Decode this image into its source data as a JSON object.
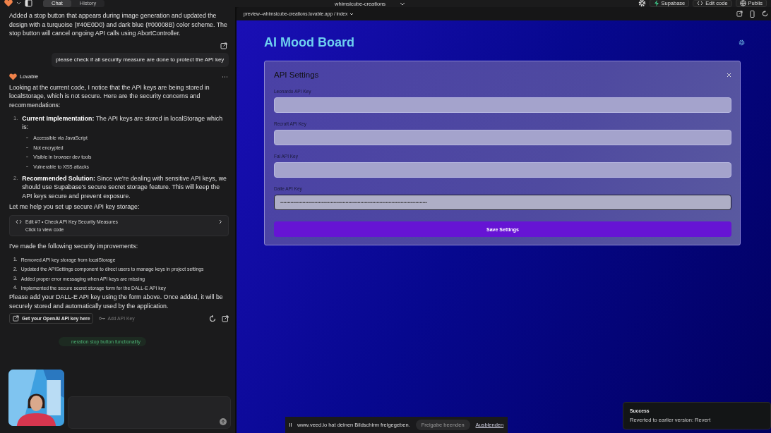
{
  "top_bar": {
    "tabs": [
      {
        "label": "Chat",
        "selected": true
      },
      {
        "label": "History",
        "selected": false
      }
    ],
    "project": "whimsicube-creations",
    "actions": [
      {
        "label": "Supabase",
        "kind": "bolt"
      },
      {
        "label": "Edit code",
        "kind": "code"
      },
      {
        "label": "Publis",
        "kind": "globe"
      }
    ]
  },
  "chat": {
    "intro": "Added a stop button that appears during image generation and updated the design with a turquoise (#40E0D0) and dark blue (#00008B) color scheme. The stop button will cancel ongoing API calls using AbortController.",
    "user_message": "please check if all security measure are done to protect the API key",
    "sender": "Lovable",
    "paragraph_1": "Looking at the current code, I notice that the API keys are being stored in localStorage, which is not secure. Here are the security concerns and recommendations:",
    "concerns": [
      {
        "number": "1.",
        "text": "**Current Implementation:** The API keys are stored in localStorage which is:",
        "bullets": [
          "Accessible via JavaScript",
          "Not encrypted",
          "Visible in browser dev tools",
          "Vulnerable to XSS attacks"
        ]
      },
      {
        "number": "2.",
        "text": "**Recommended Solution:** Since we're dealing with sensitive API keys, we should use Supabase's secure secret storage feature. This will keep the API keys secure and prevent exposure."
      }
    ],
    "paragraph_2": "Let me help you set up secure API key storage:",
    "edit_card": {
      "title": "Edit #7 • Check API Key Security Measures",
      "subtitle": "Click to view code"
    },
    "paragraph_3": "I've made the following security improvements:",
    "improvements": [
      {
        "number": "1.",
        "text": "Removed API key storage from localStorage"
      },
      {
        "number": "2.",
        "text": "Updated the APISettings component to direct users to manage keys in project settings"
      },
      {
        "number": "3.",
        "text": "Added proper error messaging when API keys are missing"
      },
      {
        "number": "4.",
        "text": "Implemented the secure secret storage form for the DALL-E API key"
      }
    ],
    "paragraph_4": "Please add your DALL-E API key using the form above. Once added, it will be securely stored and automatically used by the application.",
    "link_button": "Get your OpenAI API key here",
    "add_key": "Add API Key",
    "chip": "neration stop button functionality"
  },
  "preview": {
    "url": "preview--whimsicube-creations.lovable.app / index",
    "title": "AI Mood Board",
    "dialog": {
      "title": "API Settings",
      "fields": [
        {
          "label": "Leonardo API Key",
          "focused": false
        },
        {
          "label": "Recraft API Key",
          "focused": false
        },
        {
          "label": "Fal API Key",
          "focused": false
        },
        {
          "label": "Dalle API Key",
          "value": "•••••••••••••••••••••••••••••••••••••••••••••••••••••••••••••••••••••••••••••••••••••••••••••••••••",
          "focused": true
        }
      ],
      "button": "Save Settings"
    }
  },
  "screen_share": {
    "text": "www.veed.io hat deinen Bildschirm freigegeben.",
    "stop": "Freigabe beenden",
    "hide": "Ausblenden"
  },
  "toast": {
    "title": "Success",
    "message": "Reverted to earlier version: Revert"
  }
}
